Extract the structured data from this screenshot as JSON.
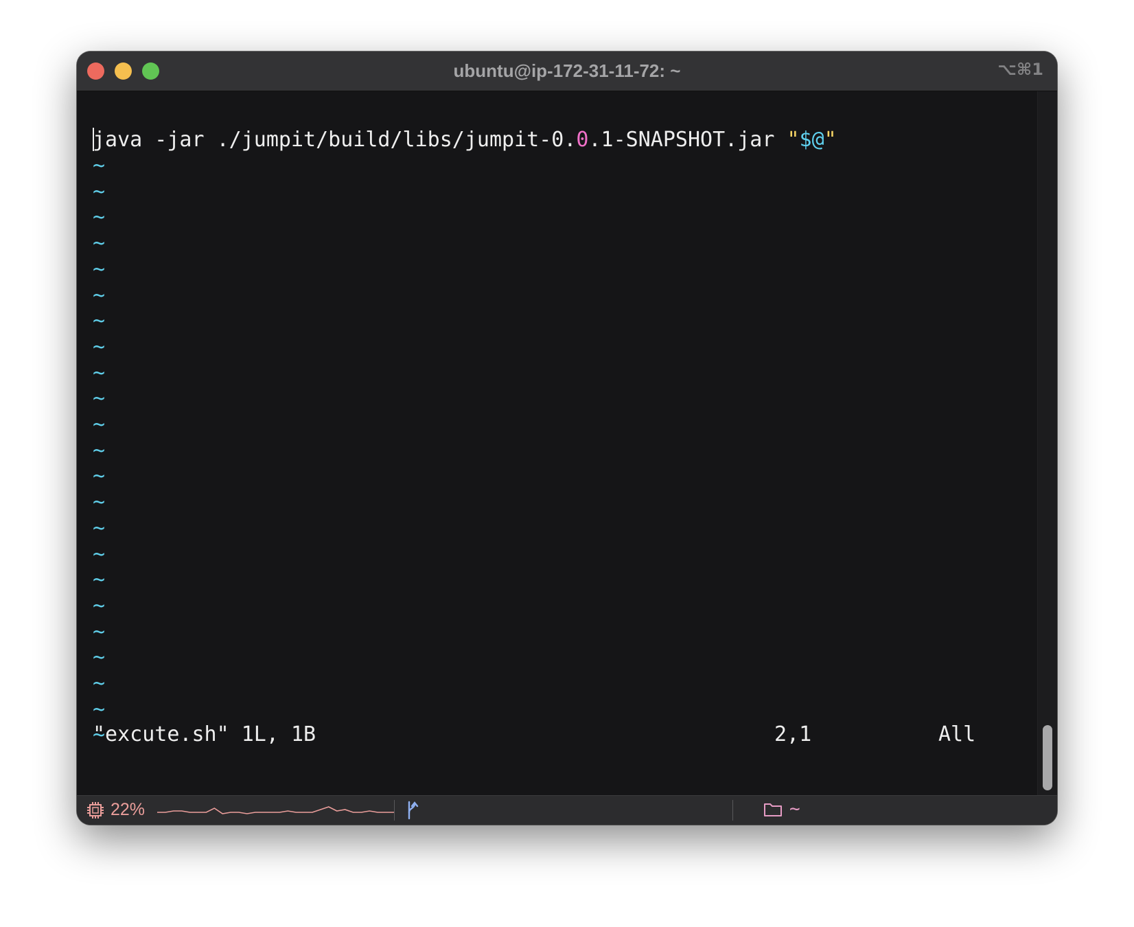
{
  "window": {
    "title": "ubuntu@ip-172-31-11-72: ~",
    "shortcut": "⌥⌘1"
  },
  "editor": {
    "line1": {
      "seg1": "java -jar ./jumpit/build/libs/jumpit-0.",
      "seg2": "0",
      "seg3": ".1-SNAPSHOT.jar ",
      "seg4": "\"",
      "seg5": "$@",
      "seg6": "\""
    },
    "tilde": "~",
    "tilde_count": 23,
    "file_message": "\"excute.sh\" 1L, 1B",
    "cursor_position": "2,1",
    "scroll_position": "All"
  },
  "statusbar": {
    "cpu_percent": "22%",
    "cpu_history": [
      3,
      3,
      4,
      4,
      3,
      3,
      3,
      6,
      2,
      3,
      3,
      2,
      3,
      3,
      3,
      3,
      4,
      3,
      3,
      3,
      5,
      7,
      4,
      5,
      3,
      3,
      4,
      3,
      3,
      3
    ],
    "directory": "~"
  },
  "colors": {
    "background": "#151517",
    "tilde": "#5fcde8",
    "number_highlight": "#f070c8",
    "string_quote": "#f4d264",
    "string_var": "#5fd0ee",
    "cpu": "#eb9e9b",
    "directory": "#e79cc5"
  }
}
